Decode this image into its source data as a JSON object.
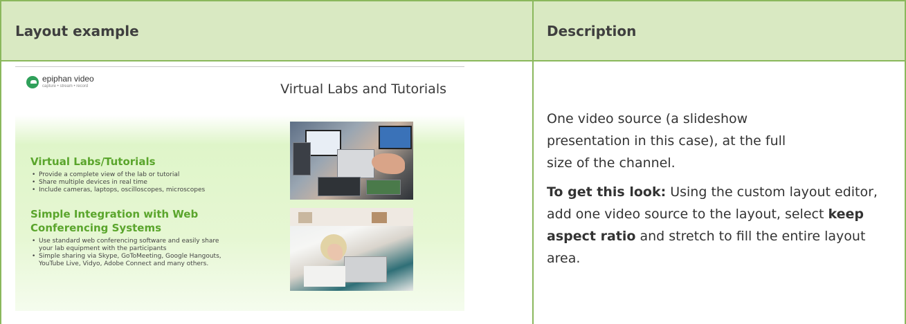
{
  "header": {
    "col1": "Layout example",
    "col2": "Description"
  },
  "slide": {
    "logo_name": "epiphan video",
    "logo_tagline": "capture • stream • record",
    "title": "Virtual Labs and Tutorials",
    "section1": {
      "heading": "Virtual Labs/Tutorials",
      "bullets": [
        "Provide a complete view of the lab or tutorial",
        "Share multiple devices in real time",
        "Include cameras, laptops, oscilloscopes, microscopes"
      ]
    },
    "section2": {
      "heading_line1": "Simple Integration with Web",
      "heading_line2": "Conferencing Systems",
      "bullets": [
        "Use standard web conferencing software and easily share your lab equipment with the participants",
        "Simple sharing via Skype, GoToMeeting, Google Hangouts, YouTube Live, Vidyo, Adobe Connect and many others."
      ]
    }
  },
  "description": {
    "para1": "One video source (a slideshow presentation in this case), at the full size of the channel.",
    "para2_bold": "To get this look:",
    "para2_a": " Using the custom layout editor, add one video source to the layout, select ",
    "para2_bold2": "keep aspect ratio",
    "para2_b": " and stretch to fill the entire layout area."
  },
  "colors": {
    "header_bg": "#d9e9c2",
    "border": "#8ab85c",
    "slide_heading": "#5aa52c"
  }
}
